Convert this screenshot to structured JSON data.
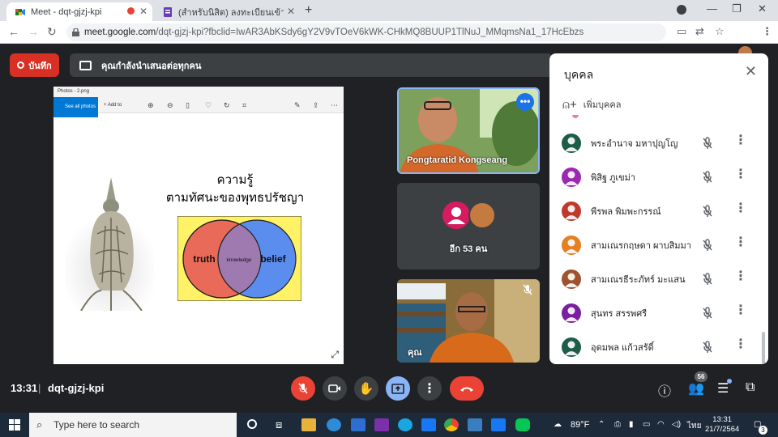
{
  "browser": {
    "tabs": [
      {
        "title": "Meet - dqt-gjzj-kpi",
        "active": true
      },
      {
        "title": "(สำหรับนิสิต) ลงทะเบียนเข้าร่วมกิจกรรม",
        "active": false
      }
    ],
    "new_tab": "+",
    "url_prefix": "meet.google.com",
    "url_rest": "/dqt-gjzj-kpi?fbclid=IwAR3AbKSdy6gY2V9vTOeV6kWK-CHkMQ8BUUP1TlNuJ_MMqmsNa1_17HcEbzs"
  },
  "meet": {
    "record_label": "บันทึก",
    "presenting_label": "คุณกำลังนำเสนอต่อทุกคน",
    "time": "13:31",
    "separator": "|",
    "meeting_code": "dqt-gjzj-kpi",
    "participants_count": "56"
  },
  "stage": {
    "photos_title": "Photos - 2.png",
    "see_all": "See all photos",
    "add_to": "+ Add to",
    "slide_title_line1": "ความรู้",
    "slide_title_line2": "ตามทัศนะของพุทธปรัชญา",
    "venn_left": "truth",
    "venn_middle": "knowledge",
    "venn_right": "belief"
  },
  "tiles": {
    "tile1_name": "Pongtaratid Kongseang",
    "tile2_label": "อีก 53 คน",
    "tile3_name": "คุณ",
    "more_icon": "more-horiz-icon"
  },
  "people_panel": {
    "title": "บุคคล",
    "add_people": "เพิ่มบุคคล",
    "people": [
      {
        "name": "พระอำนาจ มหาปุญโญ",
        "avatar_color": "#1e5c4a"
      },
      {
        "name": "พิสิฐ ภูเขม่า",
        "avatar_color": "#9c27b0"
      },
      {
        "name": "พีรพล พิมพะกรรณ์",
        "avatar_color": "#c0392b"
      },
      {
        "name": "สามเณรกฤษดา ผาบสิมมา",
        "avatar_color": "#e67e22"
      },
      {
        "name": "สามเณรธีระภัทร์ มะแสน",
        "avatar_color": "#a0522d"
      },
      {
        "name": "สุนทร สรรพศรี",
        "avatar_color": "#7b1fa2"
      },
      {
        "name": "อุดมพล แก้วสรัดิ์",
        "avatar_color": "#1e5c4a"
      }
    ]
  },
  "taskbar": {
    "search_placeholder": "Type here to search",
    "weather": "89°F",
    "lang": "ไทย",
    "clock_time": "13:31",
    "clock_date": "21/7/2564",
    "notif_count": "3"
  },
  "colors": {
    "accent_blue": "#8ab4f8",
    "red": "#ea4335",
    "meet_bg": "#202124"
  }
}
